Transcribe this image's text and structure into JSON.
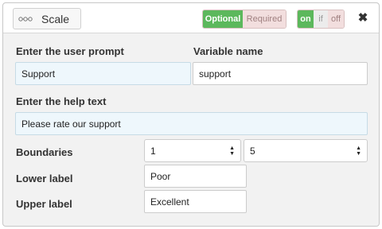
{
  "header": {
    "type_icon": "dots-connector-icon",
    "type_label": "Scale",
    "required_toggle": {
      "optional": "Optional",
      "required": "Required"
    },
    "visibility_toggle": {
      "on": "on",
      "if": "if",
      "off": "off"
    },
    "close_icon": "close-icon",
    "close_glyph": "✖",
    "colors": {
      "active": "#5cb85c",
      "inactive": "#f2dede"
    }
  },
  "prompt": {
    "label": "Enter the user prompt",
    "value": "Support"
  },
  "variable": {
    "label": "Variable name",
    "value": "support"
  },
  "help": {
    "label": "Enter the help text",
    "value": "Please rate our support"
  },
  "boundaries": {
    "label": "Boundaries",
    "lower": "1",
    "upper": "5"
  },
  "lower_label": {
    "label": "Lower label",
    "value": "Poor"
  },
  "upper_label": {
    "label": "Upper label",
    "value": "Excellent"
  }
}
